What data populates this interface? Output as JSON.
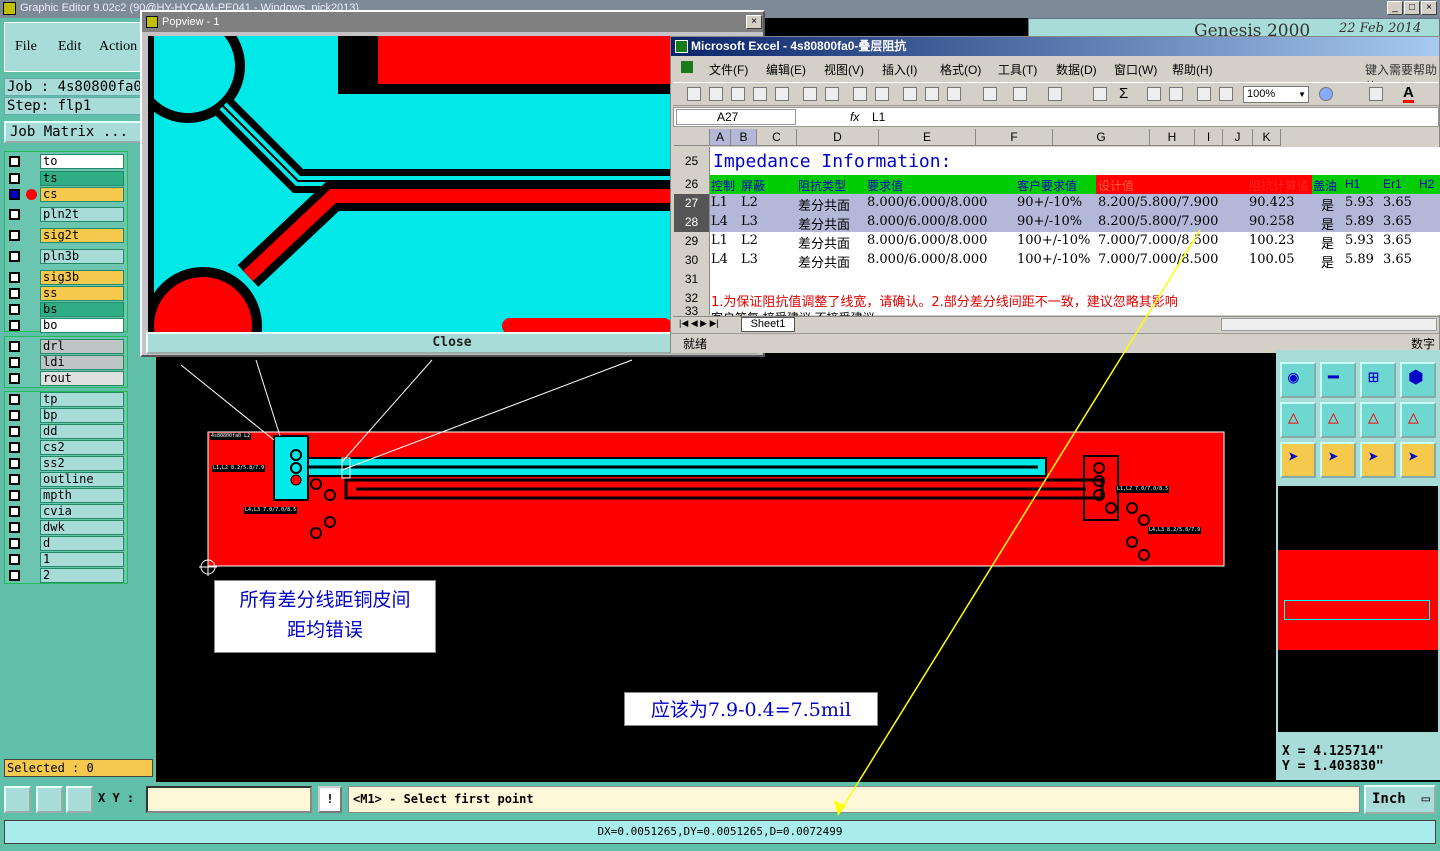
{
  "app": {
    "title": "Graphic Editor 9.02c2 (90@HY-HYCAM-PE041 - Windows_pick2013)",
    "right_title": "Genesis 2000",
    "date": "22 Feb 2014"
  },
  "menu": {
    "file": "File",
    "edit": "Edit",
    "action": "Action"
  },
  "job": {
    "job": "Job : 4s80800fa0",
    "step": "Step: flp1",
    "matrix_label": "Job Matrix ..."
  },
  "layers": [
    "to",
    "ts",
    "cs",
    "pln2t",
    "sig2t",
    "pln3b",
    "sig3b",
    "ss",
    "bs",
    "bo",
    "drl",
    "ldi",
    "rout",
    "tp",
    "bp",
    "dd",
    "cs2",
    "ss2",
    "outline",
    "mpth",
    "cvia",
    "dwk",
    "d",
    "1",
    "2"
  ],
  "selected": "Selected : 0",
  "popview": {
    "title": "Popview - 1",
    "close": "Close"
  },
  "excel": {
    "title": "Microsoft Excel - 4s80800fa0-叠层阻抗",
    "menus": [
      "文件(F)",
      "编辑(E)",
      "视图(V)",
      "插入(I)",
      "格式(O)",
      "工具(T)",
      "数据(D)",
      "窗口(W)",
      "帮助(H)"
    ],
    "help_hint": "键入需要帮助的",
    "zoom": "100%",
    "name_box": "A27",
    "fx": "fx",
    "formula": "L1",
    "columns": [
      "A",
      "B",
      "C",
      "D",
      "E",
      "F",
      "G",
      "H",
      "I",
      "J",
      "K"
    ],
    "row_numbers": [
      "25",
      "26",
      "27",
      "28",
      "29",
      "30",
      "31",
      "32",
      "33"
    ],
    "title_row": "Impedance Information:",
    "header": [
      "控制",
      "屏蔽",
      "阻抗类型",
      "要求值",
      "客户要求值",
      "设计值",
      "阻抗计算值",
      "盖油",
      "H1",
      "Er1",
      "H2"
    ],
    "rows": [
      [
        "L1",
        "L2",
        "差分共面",
        "8.000/6.000/8.000",
        "90+/-10%",
        "8.200/5.800/7.900",
        "90.423",
        "是",
        "5.93",
        "3.65"
      ],
      [
        "L4",
        "L3",
        "差分共面",
        "8.000/6.000/8.000",
        "90+/-10%",
        "8.200/5.800/7.900",
        "90.258",
        "是",
        "5.89",
        "3.65"
      ],
      [
        "L1",
        "L2",
        "差分共面",
        "8.000/6.000/8.000",
        "100+/-10%",
        "7.000/7.000/8.500",
        "100.23",
        "是",
        "5.93",
        "3.65"
      ],
      [
        "L4",
        "L3",
        "差分共面",
        "8.000/6.000/8.000",
        "100+/-10%",
        "7.000/7.000/8.500",
        "100.05",
        "是",
        "5.89",
        "3.65"
      ]
    ],
    "note": "1.为保证阻抗值调整了线宽，请确认。2.部分差分线间距不一致，建议忽略其影响",
    "row33": "客户答复    接受建议                        不接受建议",
    "sheet_tab": "Sheet1",
    "status_left": "就绪",
    "status_right": "数字"
  },
  "annotations": {
    "note1_line1": "所有差分线距铜皮间",
    "note1_line2": "距均错误",
    "note2": "应该为7.9-0.4=7.5mil"
  },
  "pcb_labels": [
    "4s80800fa0 L2",
    "L1,L2 8.2/5.8/7.9",
    "L4,L3 7.0/7.0/8.5",
    "L1,L2 7.0/7.0/8.5",
    "L4,L3 8.2/5.8/7.9"
  ],
  "coords": {
    "x": "X =  4.125714\"",
    "y": "Y =  1.403830\""
  },
  "bottom": {
    "xy_label": "X Y :",
    "xy_value": "",
    "prompt": "<M1> - Select first point",
    "unit": "Inch"
  },
  "measure": "DX=0.0051265,DY=0.0051265,D=0.0072499",
  "colors": {
    "copper": "#ff0000",
    "cyan": "#00ffff",
    "highlight": "#0000c8",
    "arrow": "#ffff00"
  }
}
